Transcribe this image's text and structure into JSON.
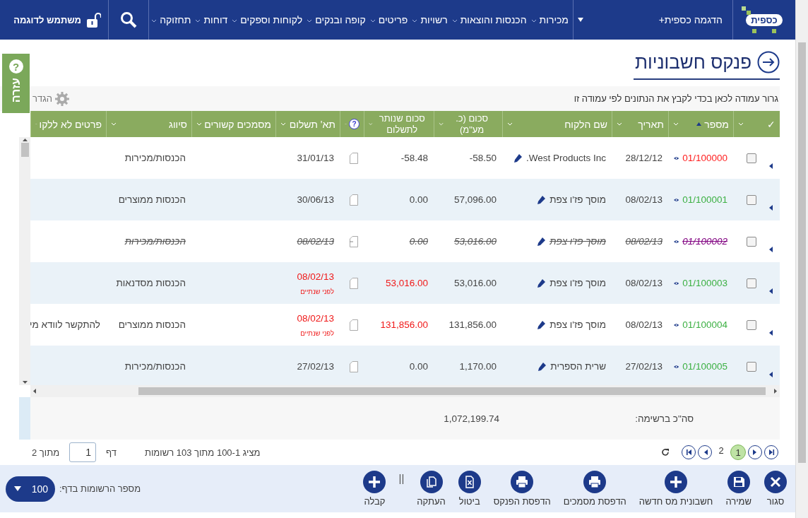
{
  "nav": {
    "logo": "כספית",
    "company": "הדגמה כספית+",
    "menu": [
      {
        "label": "מכירות"
      },
      {
        "label": "הכנסות והוצאות"
      },
      {
        "label": "רשויות"
      },
      {
        "label": "פריטים"
      },
      {
        "label": "קופה ובנקים"
      },
      {
        "label": "לקוחות וספקים"
      },
      {
        "label": "דוחות"
      },
      {
        "label": "תחזוקה"
      }
    ],
    "user": "משתמש לדוגמה"
  },
  "help_tab": {
    "icon": "?",
    "label": "עזרה"
  },
  "page_title": "פנקס חשבוניות",
  "group_bar": {
    "hint": "גרור עמודה לכאן בכדי לקבץ את הנתונים לפי עמודה זו",
    "settings": "הגדר"
  },
  "grid": {
    "columns": [
      {
        "label": "✓",
        "kind": "text"
      },
      {
        "label": "מספר",
        "kind": "text",
        "sorted": true
      },
      {
        "label": "תאריך",
        "kind": "text"
      },
      {
        "label": "שם הלקוח",
        "kind": "text"
      },
      {
        "label": "סכום (כ. מע\"מ)",
        "kind": "text"
      },
      {
        "label": "סכום שנותר לתשלום",
        "kind": "text"
      },
      {
        "label": "?",
        "kind": "help"
      },
      {
        "label": "תא' תשלום",
        "kind": "text"
      },
      {
        "label": "מסמכים קשורים",
        "kind": "text"
      },
      {
        "label": "סיווג",
        "kind": "text"
      },
      {
        "label": "פרטים לא ללקו",
        "kind": "text"
      }
    ],
    "rows": [
      {
        "checked": false,
        "number": "01/100000",
        "color": "#ff2020",
        "cancelled": false,
        "date": "28/12/12",
        "customer": "West Products Inc.",
        "amount": "-58.50",
        "remaining": "-58.48",
        "overdue": false,
        "due_date": "31/01/13",
        "category": "הכנסות/מכירות"
      },
      {
        "checked": false,
        "number": "01/100001",
        "color": "#3cb043",
        "cancelled": false,
        "date": "08/02/13",
        "customer": "מוסך פז'ו צפת",
        "amount": "57,096.00",
        "remaining": "0.00",
        "overdue": false,
        "due_date": "30/06/13",
        "category": "הכנסות ממוצרים"
      },
      {
        "checked": false,
        "number": "01/100002",
        "color": "#800080",
        "cancelled": true,
        "date": "08/02/13",
        "customer": "מוסך פז'ו צפת",
        "amount": "53,016.00",
        "remaining": "0.00",
        "overdue": false,
        "due_date": "08/02/13",
        "category": "הכנסות/מכירות"
      },
      {
        "checked": false,
        "number": "01/100003",
        "color": "#3cb043",
        "cancelled": false,
        "date": "08/02/13",
        "customer": "מוסך פז'ו צפת",
        "amount": "53,016.00",
        "remaining": "53,016.00",
        "overdue": true,
        "due_date": "08/02/13",
        "due_note": "לפני שנתיים",
        "category": "הכנסות מסדנאות"
      },
      {
        "checked": false,
        "number": "01/100004",
        "color": "#3cb043",
        "cancelled": false,
        "date": "08/02/13",
        "customer": "מוסך פז'ו צפת",
        "amount": "131,856.00",
        "remaining": "131,856.00",
        "overdue": true,
        "due_date": "08/02/13",
        "due_note": "לפני שנתיים",
        "category": "הכנסות ממוצרים",
        "details": "להתקשר לוודא מי"
      },
      {
        "checked": false,
        "number": "01/100005",
        "color": "#3cb043",
        "cancelled": false,
        "date": "27/02/13",
        "customer": "שרית הספרית",
        "amount": "1,170.00",
        "remaining": "0.00",
        "overdue": false,
        "due_date": "27/02/13",
        "category": "הכנסות/מכירות"
      }
    ],
    "total_label": "סה\"כ ברשימה:",
    "total": "1,072,199.74"
  },
  "pager": {
    "pages": [
      {
        "label": "1",
        "selected": true
      },
      {
        "label": "2",
        "selected": false
      }
    ],
    "summary": "מציג 100-1 מתוך 103 רשומות",
    "page_label": "דף",
    "page_value": "1",
    "of_total": "מתוך 2"
  },
  "actions": [
    {
      "kind": "button",
      "label": "סגור"
    },
    {
      "kind": "button",
      "label": "שמירה"
    },
    {
      "kind": "button",
      "label": "חשבונית מס חדשה"
    },
    {
      "kind": "button",
      "label": "הדפסת מסמכים"
    },
    {
      "kind": "button",
      "label": "הדפסת הפנקס"
    },
    {
      "kind": "button",
      "label": "ביטול"
    },
    {
      "kind": "button",
      "label": "העתקה"
    },
    {
      "kind": "separator",
      "label": "||"
    },
    {
      "kind": "button",
      "label": "קבלה"
    }
  ],
  "page_size": {
    "label": "מספר הרשומות בדף:",
    "value": "100"
  }
}
